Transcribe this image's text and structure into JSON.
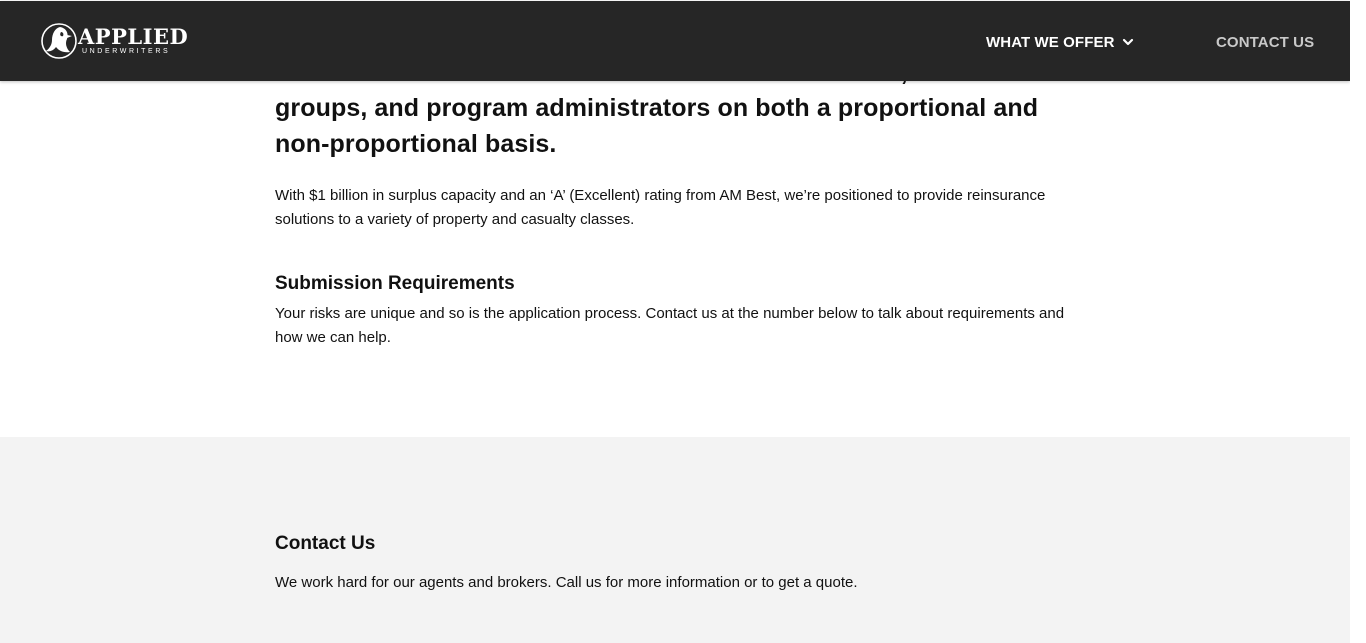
{
  "header": {
    "logo": {
      "name": "APPLIED",
      "subtitle": "UNDERWRITERS"
    },
    "nav": {
      "what_we_offer": "WHAT WE OFFER",
      "contact_us": "CONTACT US"
    }
  },
  "main": {
    "lead": "We offer reinsurance solutions to insurance carriers, risk retention groups, and program administrators on both a proportional and non-proportional basis.",
    "intro": "With $1 billion in surplus capacity and an ‘A’ (Excellent) rating from AM Best, we’re positioned to provide reinsurance solutions to a variety of property and casualty classes.",
    "submission": {
      "heading": "Submission Requirements",
      "text": "Your risks are unique and so is the application process. Contact us at the number below to talk about requirements and how we can help."
    }
  },
  "contact": {
    "heading": "Contact Us",
    "text": "We work hard for our agents and brokers. Call us for more information or to get a quote."
  },
  "colors": {
    "navbar_bg": "#262626",
    "contact_bg": "#f3f3f3",
    "nav_inactive": "#c9c9c9"
  },
  "icons": {
    "logo": "eagle-logo-icon",
    "dropdown": "chevron-down-icon"
  }
}
